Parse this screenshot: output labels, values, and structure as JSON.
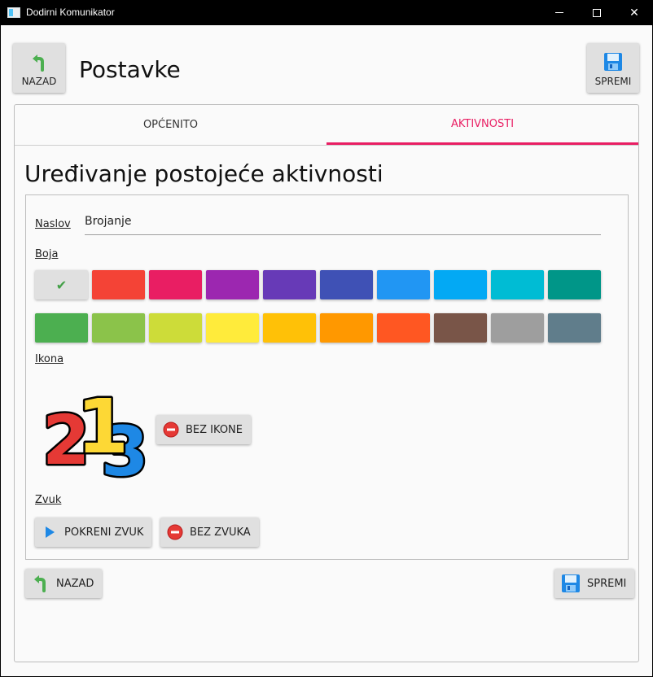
{
  "window": {
    "title": "Dodirni Komunikator"
  },
  "header": {
    "back_label": "NAZAD",
    "title": "Postavke",
    "save_label": "SPREMI"
  },
  "tabs": [
    {
      "label": "OPĆENITO",
      "selected": false
    },
    {
      "label": "AKTIVNOSTI",
      "selected": true
    }
  ],
  "editor": {
    "heading": "Uređivanje postojeće aktivnosti",
    "title_label": "Naslov",
    "title_value": "Brojanje",
    "color_label": "Boja",
    "selected_color": "none",
    "colors_row1": [
      "none",
      "#f44336",
      "#e91e63",
      "#9c27b0",
      "#673ab7",
      "#3f51b5",
      "#2196f3",
      "#03a9f4",
      "#00bcd4",
      "#009688"
    ],
    "colors_row2": [
      "#4caf50",
      "#8bc34a",
      "#cddc39",
      "#ffeb3b",
      "#ffc107",
      "#ff9800",
      "#ff5722",
      "#795548",
      "#9e9e9e",
      "#607d8b"
    ],
    "icon_label": "Ikona",
    "icon_image": "numbers-213-icon",
    "no_icon_label": "BEZ IKONE",
    "sound_label": "Zvuk",
    "play_sound_label": "POKRENI ZVUK",
    "no_sound_label": "BEZ ZVUKA"
  },
  "footer": {
    "back_label": "NAZAD",
    "save_label": "SPREMI"
  },
  "colors": {
    "accent": "#e91e63"
  }
}
